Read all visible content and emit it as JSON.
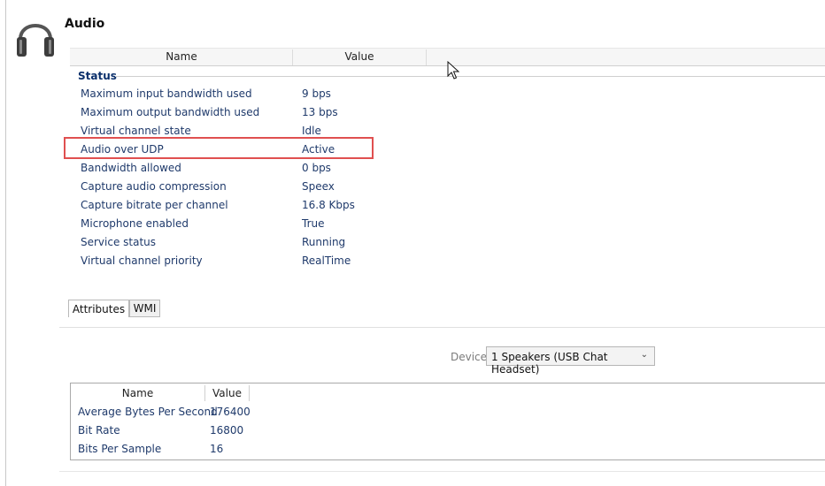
{
  "section": {
    "title": "Audio",
    "icon": "headphones-icon"
  },
  "property_grid": {
    "columns": [
      "Name",
      "Value"
    ],
    "group_title": "Status",
    "rows": [
      {
        "name": "Maximum input bandwidth used",
        "value": "9 bps"
      },
      {
        "name": "Maximum output bandwidth used",
        "value": "13 bps"
      },
      {
        "name": "Virtual channel state",
        "value": "Idle"
      },
      {
        "name": "Audio over UDP",
        "value": "Active"
      },
      {
        "name": "Bandwidth allowed",
        "value": "0 bps"
      },
      {
        "name": "Capture audio compression",
        "value": "Speex"
      },
      {
        "name": "Capture bitrate per channel",
        "value": "16.8 Kbps"
      },
      {
        "name": "Microphone enabled",
        "value": "True"
      },
      {
        "name": "Service status",
        "value": "Running"
      },
      {
        "name": "Virtual channel priority",
        "value": "RealTime"
      }
    ],
    "highlighted_row": "Audio over UDP",
    "highlight_color": "#e05050"
  },
  "tabs": [
    {
      "label": "Attributes",
      "active": true
    },
    {
      "label": "WMI",
      "active": false
    }
  ],
  "device": {
    "label": "Device:",
    "selected": "1 Speakers (USB Chat Headset)"
  },
  "attributes_grid": {
    "columns": [
      "Name",
      "Value"
    ],
    "rows": [
      {
        "name": "Average Bytes Per Second",
        "value": "176400"
      },
      {
        "name": "Bit Rate",
        "value": "16800"
      },
      {
        "name": "Bits Per Sample",
        "value": "16"
      }
    ]
  }
}
